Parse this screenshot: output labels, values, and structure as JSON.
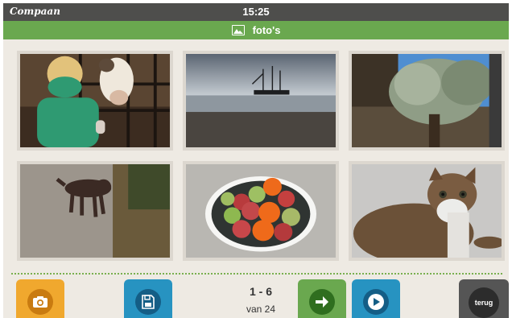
{
  "statusbar": {
    "brand": "Compaan",
    "time": "15:25"
  },
  "titlebar": {
    "icon": "image-icon",
    "title": "foto's"
  },
  "photos": [
    {
      "subject": "child-and-calf"
    },
    {
      "subject": "sailing-ship-at-sea"
    },
    {
      "subject": "olive-tree"
    },
    {
      "subject": "brown-dog"
    },
    {
      "subject": "bowl-of-fruit"
    },
    {
      "subject": "tabby-kitten"
    }
  ],
  "pager": {
    "range": "1 - 6",
    "total": "van 24"
  },
  "buttons": {
    "camera_icon": "camera-icon",
    "save_icon": "save-icon",
    "next_icon": "arrow-right-icon",
    "play_icon": "play-icon",
    "back_label": "terug"
  },
  "colors": {
    "statusbar": "#4e4e4c",
    "titlebar": "#6aa84f",
    "background": "#eeeae3",
    "camera_button": "#f0a82e",
    "save_button": "#2793c1",
    "next_button": "#6aa84f",
    "play_button": "#2793c1",
    "back_button": "#555555"
  }
}
